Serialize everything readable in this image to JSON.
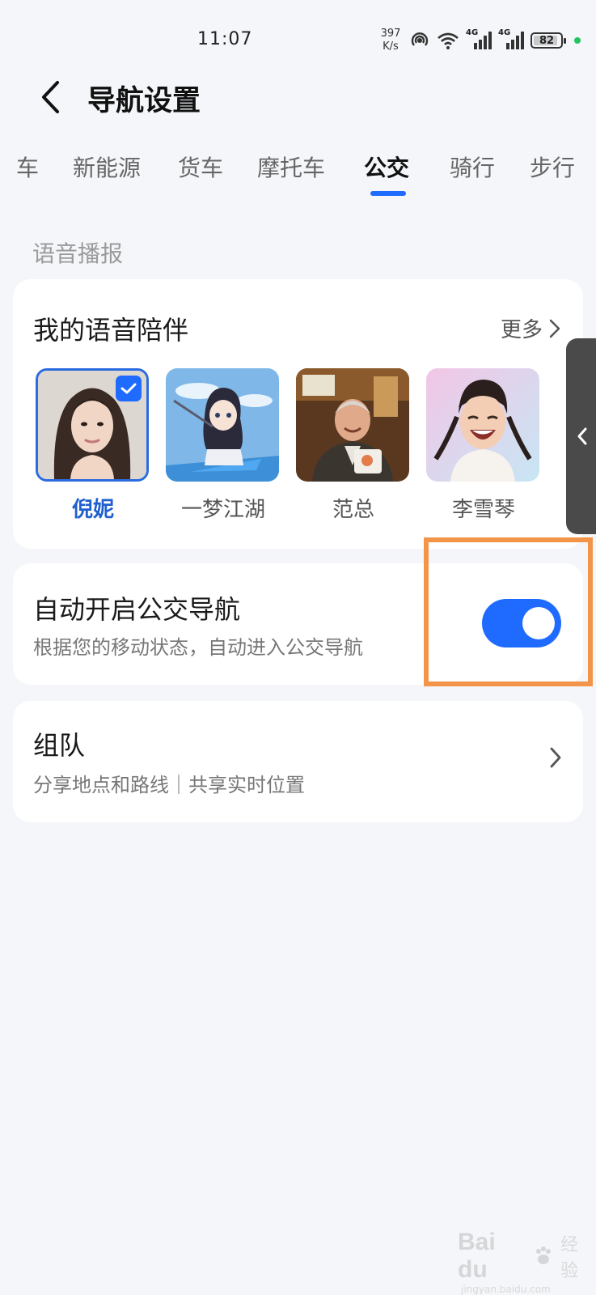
{
  "status_bar": {
    "time": "11:07",
    "net_speed_value": "397",
    "net_speed_unit": "K/s",
    "network_left": "4G",
    "network_right": "4G",
    "battery": "82",
    "icons": [
      "hotspot-icon",
      "wifi-icon",
      "signal-4g-icon",
      "signal-4g-icon",
      "battery-icon",
      "active-dot-icon"
    ]
  },
  "header": {
    "title": "导航设置",
    "back_icon": "chevron-left-icon"
  },
  "tabs": {
    "items": [
      {
        "label": "车"
      },
      {
        "label": "新能源"
      },
      {
        "label": "货车"
      },
      {
        "label": "摩托车"
      },
      {
        "label": "公交"
      },
      {
        "label": "骑行"
      },
      {
        "label": "步行"
      }
    ],
    "active_index": 4,
    "accent": "#1f6bff"
  },
  "voice_section": {
    "label": "语音播报",
    "card_title": "我的语音陪伴",
    "more_label": "更多",
    "avatars": [
      {
        "name": "倪妮",
        "selected": true
      },
      {
        "name": "一梦江湖",
        "selected": false
      },
      {
        "name": "范总",
        "selected": false
      },
      {
        "name": "李雪琴",
        "selected": false
      }
    ]
  },
  "auto_bus": {
    "title": "自动开启公交导航",
    "description": "根据您的移动状态，自动进入公交导航",
    "enabled": true
  },
  "team": {
    "title": "组队",
    "description": "分享地点和路线｜共享实时位置"
  },
  "watermark": {
    "text": "Bai du",
    "cn": "经验",
    "url": "jingyan.baidu.com"
  }
}
